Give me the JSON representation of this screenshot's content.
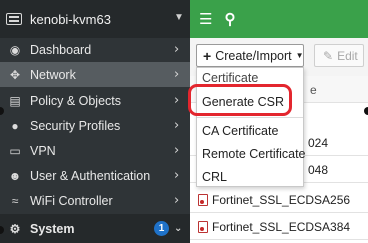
{
  "header": {
    "device_name": "kenobi-kvm63"
  },
  "sidebar": {
    "items": [
      {
        "label": "Dashboard",
        "icon": "dashboard-icon"
      },
      {
        "label": "Network",
        "icon": "network-icon",
        "active": true
      },
      {
        "label": "Policy & Objects",
        "icon": "policy-icon"
      },
      {
        "label": "Security Profiles",
        "icon": "lock-icon"
      },
      {
        "label": "VPN",
        "icon": "monitor-icon"
      },
      {
        "label": "User & Authentication",
        "icon": "user-icon"
      },
      {
        "label": "WiFi Controller",
        "icon": "wifi-icon"
      },
      {
        "label": "System",
        "icon": "gear-icon",
        "badge": "1"
      }
    ]
  },
  "toolbar": {
    "create_import_label": "Create/Import",
    "edit_label": "Edit"
  },
  "dropdown": {
    "items": [
      "Certificate",
      "Generate CSR",
      "CA Certificate",
      "Remote Certificate",
      "CRL"
    ],
    "highlighted": "Generate CSR"
  },
  "table": {
    "rows": [
      {
        "name": "024",
        "partial": true
      },
      {
        "name": "048",
        "partial": true
      },
      {
        "name": "Fortinet_SSL_ECDSA256"
      },
      {
        "name": "Fortinet_SSL_ECDSA384"
      }
    ],
    "header_fragment": "e"
  },
  "colors": {
    "sidebar_bg": "#2f3437",
    "topbar_green": "#3aa14a",
    "highlight_red": "#e3262e",
    "badge_blue": "#1f72c9"
  }
}
